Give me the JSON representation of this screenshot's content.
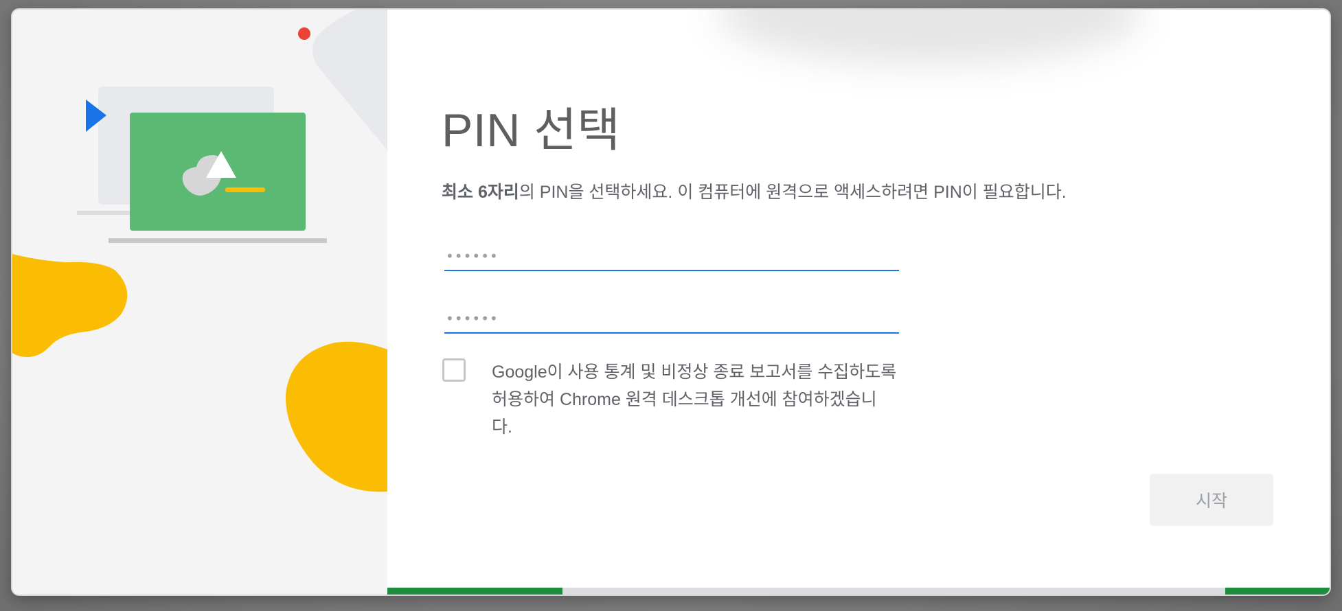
{
  "dialog": {
    "title": "PIN 선택",
    "description": {
      "bold": "최소 6자리",
      "rest": "의 PIN을 선택하세요. 이 컴퓨터에 원격으로 액세스하려면 PIN이 필요합니다."
    },
    "pin_input": {
      "placeholder": "••••••",
      "value": ""
    },
    "pin_confirm_input": {
      "placeholder": "••••••",
      "value": ""
    },
    "consent_checkbox": {
      "checked": false,
      "label": "Google이 사용 통계 및 비정상 종료 보고서를 수집하도록 허용하여 Chrome 원격 데스크톱 개선에 참여하겠습니다."
    },
    "start_button": {
      "label": "시작",
      "enabled": false
    }
  },
  "illustration": {
    "icons": [
      "laptop-illustration-icon",
      "play-triangle-icon",
      "red-dot-icon",
      "yellow-blob-icon"
    ]
  },
  "progress": {
    "color": "#1e8e3e",
    "track_color": "#dadce0"
  },
  "colors": {
    "accent": "#1a73e8",
    "green": "#5bb974",
    "yellow": "#fbbc04",
    "red": "#ea4335",
    "blue": "#1a73e8"
  }
}
